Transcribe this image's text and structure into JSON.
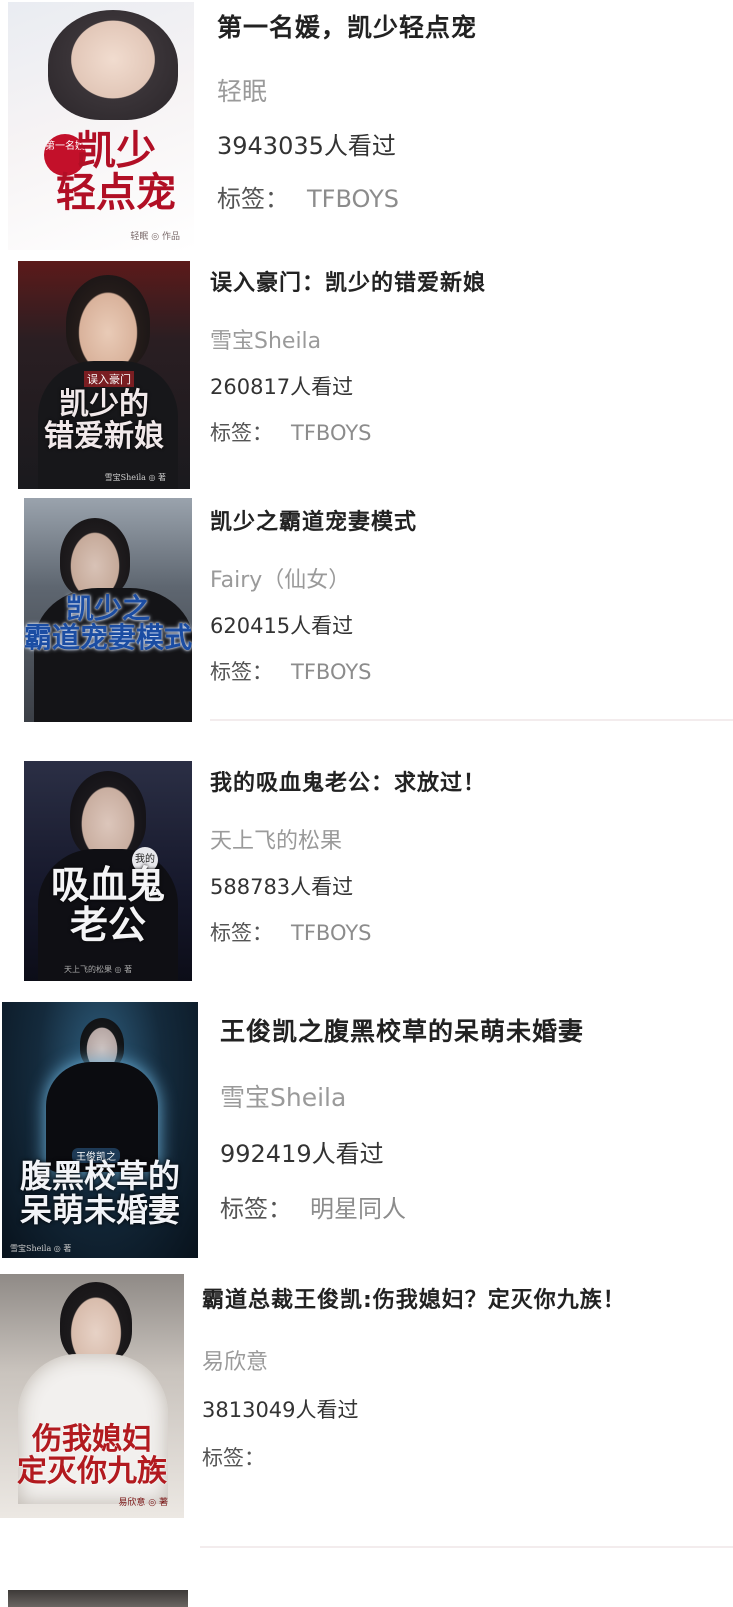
{
  "books": [
    {
      "title": "第一名媛，凯少轻点宠",
      "author": "轻眠",
      "views": "3943035人看过",
      "tag_label": "标签：",
      "tag": "TFBOYS",
      "cover_text": "凯少\n轻点宠",
      "cover_sub": "第一名媛",
      "cover_credit": "轻眠 ◎ 作品"
    },
    {
      "title": "误入豪门：凯少的错爱新娘",
      "author": "雪宝Sheila",
      "views": "260817人看过",
      "tag_label": "标签：",
      "tag": "TFBOYS",
      "cover_text": "凯少的\n错爱新娘",
      "cover_sub": "误入豪门",
      "cover_credit": "雪宝Sheila ◎ 著"
    },
    {
      "title": "凯少之霸道宠妻模式",
      "author": "Fairy（仙女）",
      "views": "620415人看过",
      "tag_label": "标签：",
      "tag": "TFBOYS",
      "cover_text": "凯少之\n霸道宠妻模式"
    },
    {
      "title": "我的吸血鬼老公：求放过！",
      "author": "天上飞的松果",
      "views": "588783人看过",
      "tag_label": "标签：",
      "tag": "TFBOYS",
      "cover_text": "吸血鬼\n老公",
      "cover_sub": "我的",
      "cover_credit": "天上飞的松果 ◎ 著"
    },
    {
      "title": "王俊凯之腹黑校草的呆萌未婚妻",
      "author": "雪宝Sheila",
      "views": "992419人看过",
      "tag_label": "标签：",
      "tag": "明星同人",
      "cover_text": "腹黑校草的\n呆萌未婚妻",
      "cover_sub": "王俊凯之",
      "cover_credit": "雪宝Sheila ◎ 著"
    },
    {
      "title": "霸道总裁王俊凯:伤我媳妇？定灭你九族！",
      "author": "易欣意",
      "views": "3813049人看过",
      "tag_label": "标签：",
      "tag": "",
      "cover_text": "伤我媳妇\n定灭你九族",
      "cover_credit": "易欣意 ◎ 著"
    }
  ],
  "colors": {
    "title": "#222222",
    "author": "#9a9a9a",
    "views": "#333333",
    "tag": "#8c8c8c",
    "separator": "#f3eced"
  }
}
